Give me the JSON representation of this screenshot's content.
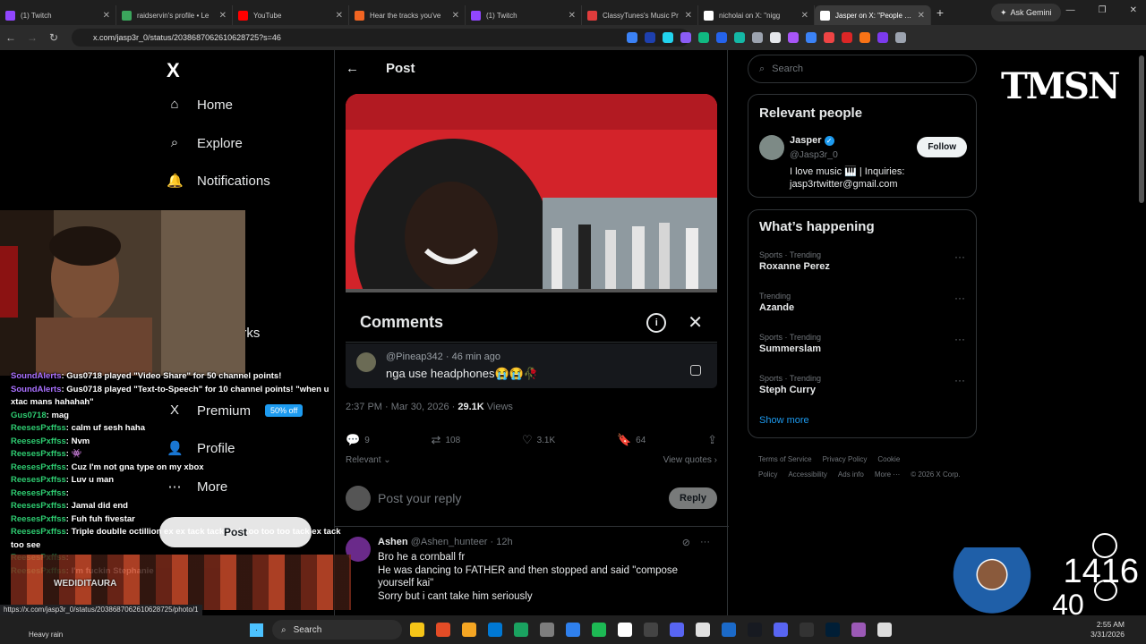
{
  "browser": {
    "tabs": [
      {
        "title": "(1) Twitch",
        "color": "#9146ff"
      },
      {
        "title": "raidservin's profile • Le",
        "color": "#3ba55c"
      },
      {
        "title": "YouTube",
        "color": "#ff0000"
      },
      {
        "title": "Hear the tracks you've",
        "color": "#f26522"
      },
      {
        "title": "(1) Twitch",
        "color": "#9146ff"
      },
      {
        "title": "ClassyTunes's Music Pr",
        "color": "#e03c3c"
      },
      {
        "title": "nicholai on X: \"nigg",
        "color": "#ffffff"
      },
      {
        "title": "Jasper on X: \"People ha",
        "color": "#ffffff"
      }
    ],
    "gemini_label": "Ask Gemini",
    "url": "x.com/jasp3r_0/status/2038687062610628725?s=46"
  },
  "nav": {
    "logo": "X",
    "items": [
      {
        "label": "Home",
        "icon": "home-icon"
      },
      {
        "label": "Explore",
        "icon": "search-icon"
      },
      {
        "label": "Notifications",
        "icon": "bell-icon"
      },
      {
        "label": "arks",
        "icon": "bookmark-icon"
      },
      {
        "label": "Premium",
        "icon": "x-icon"
      },
      {
        "label": "Profile",
        "icon": "person-icon"
      },
      {
        "label": "More",
        "icon": "more-icon"
      }
    ],
    "premium_badge": "50% off",
    "post_button": "Post"
  },
  "post": {
    "header": "Post",
    "comments_title": "Comments",
    "comment": {
      "handle": "@Pineap342",
      "time": "46 min ago",
      "text": "nga use headphones😭😭🥀"
    },
    "timestamp": "2:37 PM · Mar 30, 2026 ·",
    "views_count": "29.1K",
    "views_label": "Views",
    "stats": {
      "replies": "9",
      "reposts": "108",
      "likes": "3.1K",
      "bookmarks": "64"
    },
    "relevant": "Relevant",
    "view_quotes": "View quotes",
    "reply_placeholder": "Post your reply",
    "reply_button": "Reply",
    "reply": {
      "name": "Ashen",
      "handle": "@Ashen_hunteer",
      "time": "12h",
      "lines": [
        "Bro he a cornball fr",
        "He was dancing to FATHER and then stopped and said \"compose yourself kai\"",
        "Sorry but i cant take him seriously"
      ]
    }
  },
  "sidebar": {
    "search_placeholder": "Search",
    "relevant_title": "Relevant people",
    "person": {
      "name": "Jasper",
      "handle": "@Jasp3r_0",
      "bio_line1": "I love music 🎹 | Inquiries:",
      "bio_line2": "jasp3rtwitter@gmail.com",
      "follow": "Follow"
    },
    "happening_title": "What’s happening",
    "trends": [
      {
        "category": "Sports · Trending",
        "name": "Roxanne Perez"
      },
      {
        "category": "Trending",
        "name": "Azande"
      },
      {
        "category": "Sports · Trending",
        "name": "Summerslam"
      },
      {
        "category": "Sports · Trending",
        "name": "Steph Curry"
      }
    ],
    "show_more": "Show more",
    "footer": [
      "Terms of Service",
      "Privacy Policy",
      "Cookie Policy",
      "Accessibility",
      "Ads info",
      "More ···",
      "© 2026 X Corp."
    ]
  },
  "stream": {
    "chat": [
      {
        "user": "SoundAlerts",
        "msg": "Gus0718 played \"Video Share\" for 50 channel points!"
      },
      {
        "user": "SoundAlerts",
        "msg": "Gus0718 played \"Text-to-Speech\" for 10 channel points! \"when u xtac mans hahahah\""
      },
      {
        "user": "Gus0718",
        "msg": "mag"
      },
      {
        "user": "ReesesPxffss",
        "msg": "calm uf sesh haha"
      },
      {
        "user": "ReesesPxffss",
        "msg": "Nvm"
      },
      {
        "user": "ReesesPxffss",
        "msg": "👾"
      },
      {
        "user": "ReesesPxffss",
        "msg": "Cuz I'm not gna type on my xbox"
      },
      {
        "user": "ReesesPxffss",
        "msg": "Luv u man"
      },
      {
        "user": "ReesesPxffss",
        "msg": ""
      },
      {
        "user": "ReesesPxffss",
        "msg": "Jamal did end"
      },
      {
        "user": "ReesesPxffss",
        "msg": "Fuh fuh fivestar"
      },
      {
        "user": "ReesesPxffss",
        "msg": "Triple doublle octillion ex ex tack tack tack too too too tack ex tack too see"
      },
      {
        "user": "ReesesPxffss",
        "msg": ""
      },
      {
        "user": "ReesesPxffss",
        "msg": "I'm fuckin Stephanie"
      }
    ],
    "emote_user": "WEDIDITAURA",
    "logo_text": "TMSN",
    "counter_top": "1416",
    "counter_bottom": "40",
    "status_url": "https://x.com/jasp3r_0/status/2038687062610628725/photo/1"
  },
  "taskbar": {
    "weather": "Heavy rain",
    "search": "Search",
    "time": "2:55 AM",
    "date": "3/31/2026"
  }
}
